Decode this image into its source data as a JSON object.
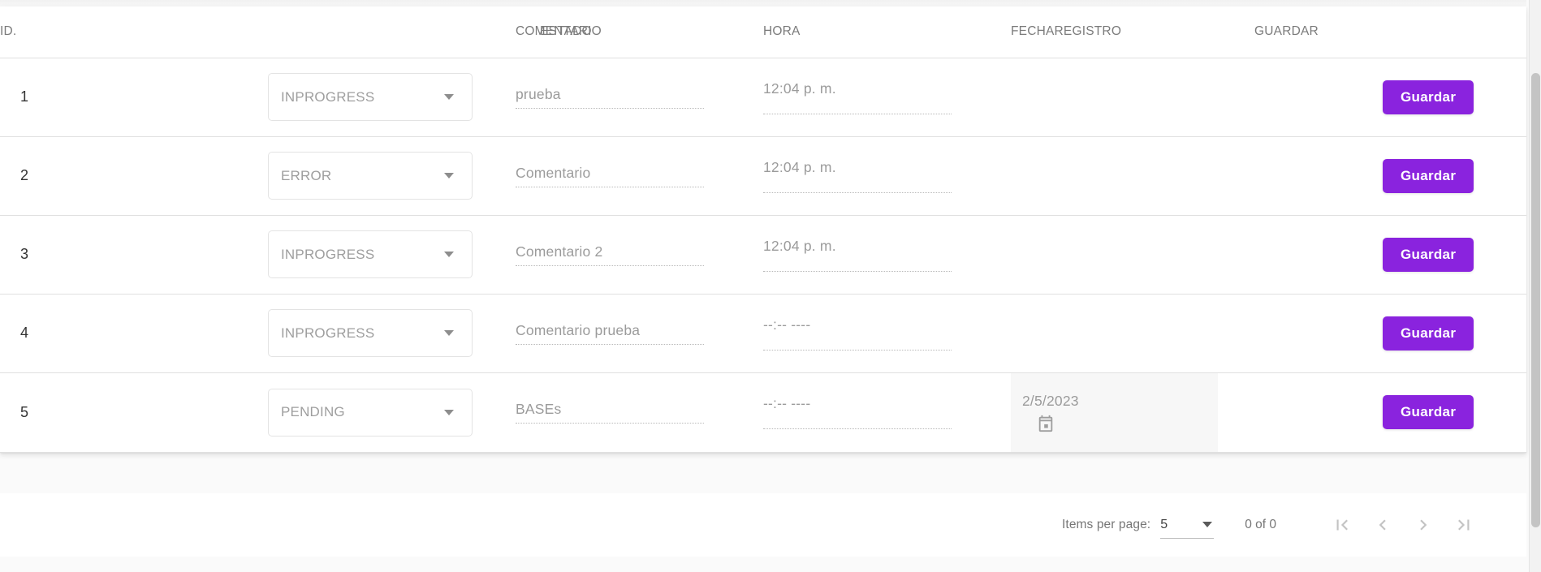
{
  "table": {
    "columns": [
      {
        "key": "id",
        "label": "ID."
      },
      {
        "key": "estado",
        "label": "ESTADO"
      },
      {
        "key": "comentario",
        "label": "COMENTARIO"
      },
      {
        "key": "hora",
        "label": "HORA"
      },
      {
        "key": "fecharegistro",
        "label": "FECHAREGISTRO"
      },
      {
        "key": "guardar",
        "label": "GUARDAR"
      }
    ],
    "rows": [
      {
        "id": "1",
        "estado": "INPROGRESS",
        "comentario": "prueba",
        "hora": "12:04 p. m.",
        "fecharegistro": "",
        "guardar_label": "Guardar"
      },
      {
        "id": "2",
        "estado": "ERROR",
        "comentario": "Comentario",
        "hora": "12:04 p. m.",
        "fecharegistro": "",
        "guardar_label": "Guardar"
      },
      {
        "id": "3",
        "estado": "INPROGRESS",
        "comentario": "Comentario 2",
        "hora": "12:04 p. m.",
        "fecharegistro": "",
        "guardar_label": "Guardar"
      },
      {
        "id": "4",
        "estado": "INPROGRESS",
        "comentario": "Comentario prueba",
        "hora": "--:-- ----",
        "fecharegistro": "",
        "guardar_label": "Guardar"
      },
      {
        "id": "5",
        "estado": "PENDING",
        "comentario": "BASEs",
        "hora": "--:-- ----",
        "fecharegistro": "2/5/2023",
        "guardar_label": "Guardar"
      }
    ]
  },
  "paginator": {
    "items_per_page_label": "Items per page:",
    "items_per_page_value": "5",
    "range_label": "0 of 0",
    "first_page_icon": "first-page-icon",
    "previous_page_icon": "previous-page-icon",
    "next_page_icon": "next-page-icon",
    "last_page_icon": "last-page-icon"
  },
  "icons": {
    "calendar": "calendar-icon",
    "dropdown_caret": "chevron-down-icon"
  },
  "colors": {
    "accent_purple": "#8A23DE",
    "header_text": "#7b7b7b",
    "placeholder_text": "#9b9b9b",
    "row_divider": "#e0e0e0",
    "date_field_bg": "#f7f7f7"
  }
}
